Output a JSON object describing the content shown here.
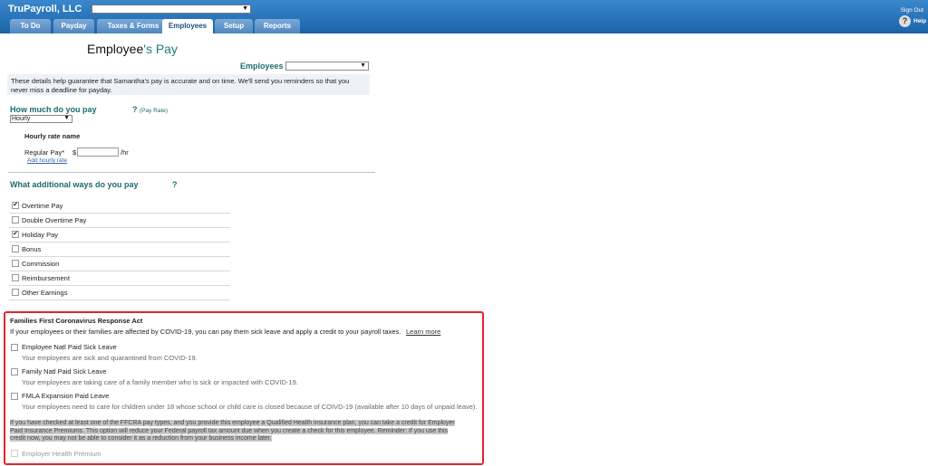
{
  "header": {
    "company": "TruPayroll, LLC",
    "sign_out": "Sign Out",
    "help_icon_glyph": "?",
    "help": "Help",
    "tabs": [
      {
        "label": "To Do",
        "active": false
      },
      {
        "label": "Payday",
        "active": false
      },
      {
        "label": "Taxes & Forms",
        "active": false
      },
      {
        "label": "Employees",
        "active": true
      },
      {
        "label": "Setup",
        "active": false
      },
      {
        "label": "Reports",
        "active": false
      }
    ]
  },
  "page": {
    "title_main": "Employee",
    "title_accent": "'s Pay",
    "employees_label": "Employees",
    "info": "These details help guarantee that Samantha's pay is accurate and on time. We'll send you reminders so that you never miss a deadline for payday."
  },
  "pay": {
    "title": "How much do you pay",
    "help_q": "?",
    "help_link": "(Pay Rate)",
    "pay_type": "Hourly",
    "rate_heading": "Hourly rate name",
    "regular_label": "Regular Pay*",
    "currency": "$",
    "unit": "/hr",
    "rate_value": "",
    "add_rate": "Add hourly rate"
  },
  "additional": {
    "title": "What additional ways do you pay",
    "help_q": "?",
    "items": [
      {
        "label": "Overtime Pay",
        "checked": true
      },
      {
        "label": "Double Overtime Pay",
        "checked": false
      },
      {
        "label": "Holiday Pay",
        "checked": true
      },
      {
        "label": "Bonus",
        "checked": false
      },
      {
        "label": "Commission",
        "checked": false
      },
      {
        "label": "Reimbursement",
        "checked": false
      },
      {
        "label": "Other Earnings",
        "checked": false
      }
    ]
  },
  "ffcra": {
    "title": "Families First Coronavirus Response Act",
    "intro": "If your employees or their families are affected by COVID-19, you can pay them sick leave and apply a credit to your payroll taxes.",
    "learn_more": "Learn more",
    "items": [
      {
        "label": "Employee Natl Paid Sick Leave",
        "desc": "Your employees are sick and quarantined from COVID-19."
      },
      {
        "label": "Family Natl Paid Sick Leave",
        "desc": "Your employees are taking care of a family member who is sick or impacted with COVID-19."
      },
      {
        "label": "FMLA Expansion Paid Leave",
        "desc": "Your employees need to care for children under 18 whose school or child care is closed because of COIVD-19 (available after 10 days of unpaid leave)."
      }
    ],
    "note": "If you have checked at least one of the FFCRA pay types, and you provide this employee a Qualified Health insurance plan, you can take a credit for Employer Paid Insurance Premiums. This option will reduce your Federal payroll tax amount due when you create a check for this employee. Reminder: If you use this credit now, you may not be able to consider it as a reduction from your business income later.",
    "employer_health": "Employer Health Premium"
  }
}
